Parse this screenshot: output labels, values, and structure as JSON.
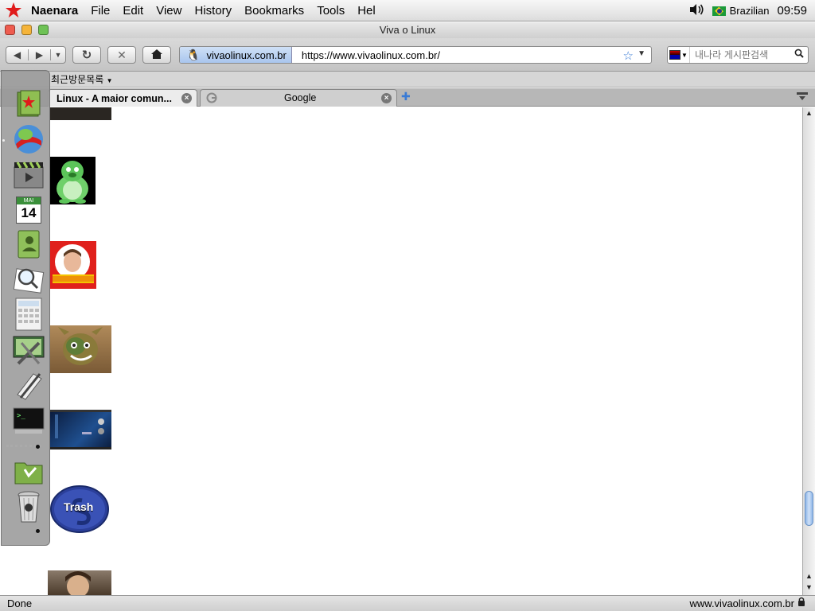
{
  "menubar": {
    "app_name": "Naenara",
    "menus": [
      "File",
      "Edit",
      "View",
      "History",
      "Bookmarks",
      "Tools",
      "Hel"
    ],
    "input_language": "Brazilian",
    "clock": "09:59"
  },
  "window": {
    "title": "Viva o Linux"
  },
  "navbar": {
    "site_identity": "vivaolinux.com.br",
    "url": "https://www.vivaolinux.com.br/",
    "search_placeholder": "내나라 게시판검색"
  },
  "bookmarks": {
    "recent_label": "최근방문목록"
  },
  "tabs": [
    {
      "title": "Linux - A maior comun...",
      "active": true
    },
    {
      "title": "Google",
      "active": false
    }
  ],
  "dock": {
    "calendar_month": "MAI",
    "calendar_day": "14",
    "trash_label": "Trash"
  },
  "status": {
    "left": "Done",
    "right": "www.vivaolinux.com.br"
  },
  "colors": {
    "accent": "#3a7bd5",
    "star": "#e01b1b"
  }
}
